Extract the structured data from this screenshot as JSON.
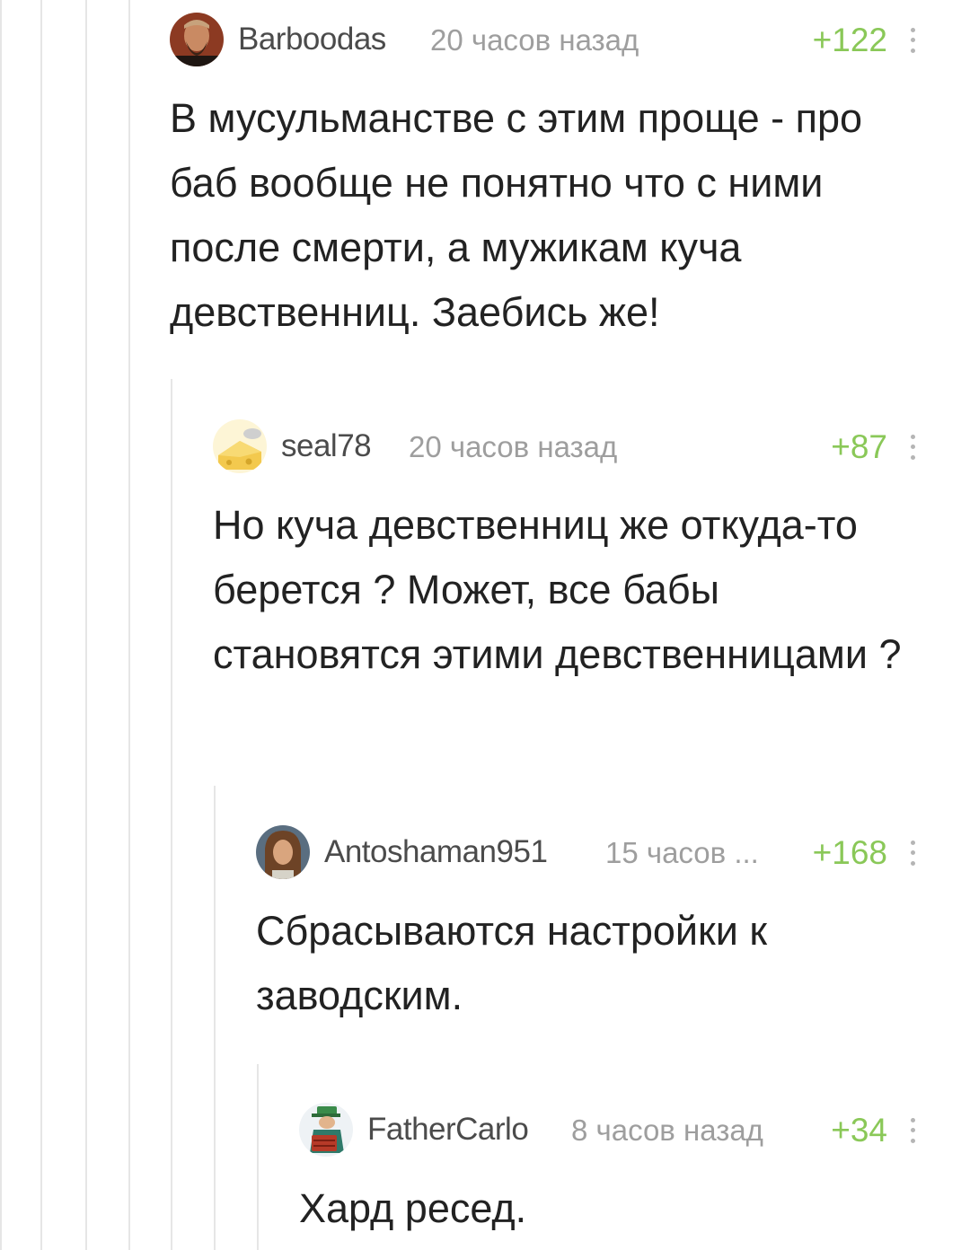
{
  "colors": {
    "rating": "#8ac858",
    "thread_line": "#e6e6e6",
    "author": "#4b4b4b",
    "time": "#9e9e9e",
    "text": "#222222"
  },
  "comments": [
    {
      "author": "Barboodas",
      "time": "20 часов назад",
      "rating": "+122",
      "avatar_icon": "bearded-man-avatar-icon",
      "text": "В мусульманстве с этим проще - про баб вообще не понятно что с ними после смерти, а мужикам куча девственниц. Заебись же!"
    },
    {
      "author": "seal78",
      "time": "20 часов назад",
      "rating": "+87",
      "avatar_icon": "cheese-avatar-icon",
      "text": "Но куча девственниц же откуда-то берется ? Может, все бабы становятся этими девственницами ?"
    },
    {
      "author": "Antoshaman951",
      "time": "15 часов ...",
      "rating": "+168",
      "avatar_icon": "long-haired-man-avatar-icon",
      "text": "Сбрасываются настройки к заводским."
    },
    {
      "author": "FatherCarlo",
      "time": "8 часов назад",
      "rating": "+34",
      "avatar_icon": "organ-grinder-avatar-icon",
      "text": "Хард ресед."
    }
  ]
}
